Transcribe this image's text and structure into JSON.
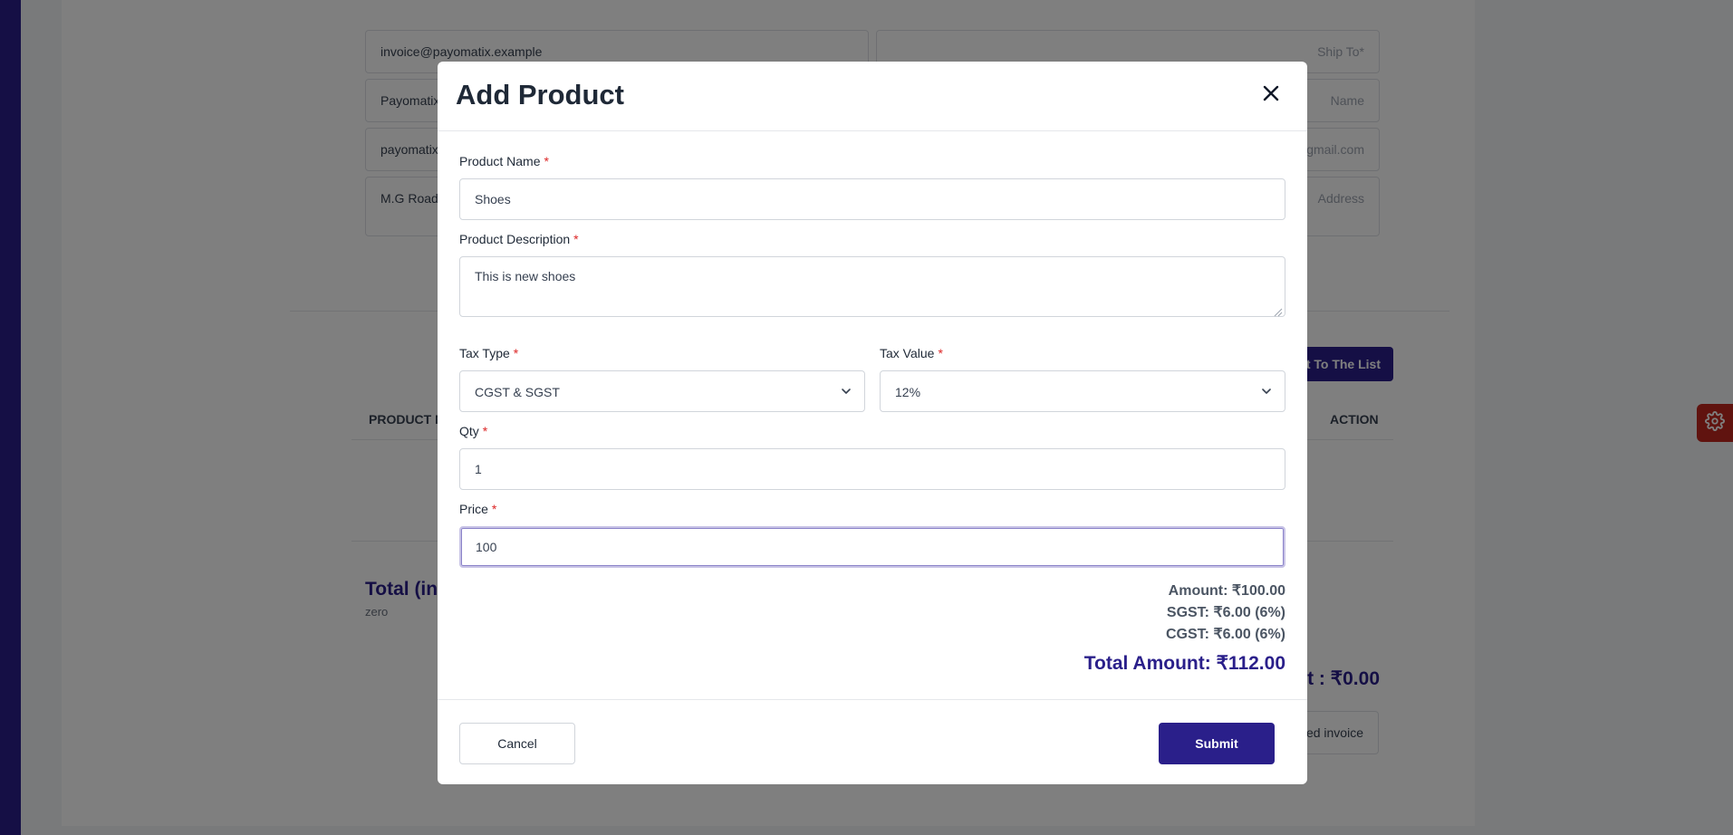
{
  "background": {
    "from_email": "invoice@payomatix.example",
    "from_name": "Payomatix",
    "from_email2": "payomatix",
    "from_address": "M.G Road,",
    "ship_to_placeholder": "Ship To*",
    "name_placeholder": "Name",
    "email_placeholder": "gmail.com",
    "address_placeholder": "Address",
    "add_to_list_button": "ct To The List",
    "col_product_name": "PRODUCT N",
    "col_action": "ACTION",
    "total_label": "Total (in ",
    "total_words": "zero",
    "grand_total": "nt : ₹0.00",
    "invoice_button": "ed invoice"
  },
  "modal": {
    "title": "Add Product",
    "product_name": {
      "label": "Product Name",
      "required": "*",
      "value": "Shoes"
    },
    "product_description": {
      "label": "Product Description",
      "required": "*",
      "value": "This is new shoes"
    },
    "tax_type": {
      "label": "Tax Type",
      "required": "*",
      "value": "CGST & SGST"
    },
    "tax_value": {
      "label": "Tax Value",
      "required": "*",
      "value": "12%"
    },
    "qty": {
      "label": "Qty",
      "required": "*",
      "value": "1"
    },
    "price": {
      "label": "Price",
      "required": "*",
      "value": "100"
    },
    "summary": {
      "amount": "Amount: ₹100.00",
      "sgst": "SGST: ₹6.00 (6%)",
      "cgst": "CGST: ₹6.00 (6%)",
      "total": "Total Amount: ₹112.00"
    },
    "cancel_label": "Cancel",
    "submit_label": "Submit"
  },
  "colors": {
    "brand": "#2a1f8a",
    "required": "#dc2626",
    "settings_tab": "#c0271f"
  },
  "icons": [
    "close-icon",
    "chevron-down-icon",
    "gear-icon"
  ]
}
